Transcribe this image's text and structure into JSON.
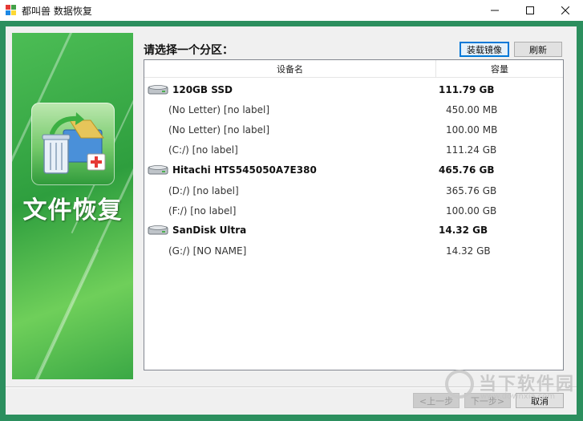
{
  "window": {
    "title": "都叫兽 数据恢复",
    "controls": {
      "minimize": "minimize-icon",
      "maximize": "maximize-icon",
      "close": "close-icon"
    }
  },
  "banner": {
    "icon": "recycle-bin-folder-restore-icon",
    "title": "文件恢复"
  },
  "main": {
    "prompt": "请选择一个分区：",
    "mount_image_label": "装载镜像",
    "refresh_label": "刷新",
    "columns": {
      "device": "设备名",
      "capacity": "容量"
    },
    "rows": [
      {
        "type": "disk",
        "name": "120GB SSD",
        "size": "111.79 GB"
      },
      {
        "type": "partition",
        "name": "(No Letter) [no label]",
        "size": "450.00 MB"
      },
      {
        "type": "partition",
        "name": "(No Letter) [no label]",
        "size": "100.00 MB"
      },
      {
        "type": "partition",
        "name": "(C:/) [no label]",
        "size": "111.24 GB"
      },
      {
        "type": "disk",
        "name": "Hitachi HTS545050A7E380",
        "size": "465.76 GB"
      },
      {
        "type": "partition",
        "name": "(D:/) [no label]",
        "size": "365.76 GB"
      },
      {
        "type": "partition",
        "name": "(F:/) [no label]",
        "size": "100.00 GB"
      },
      {
        "type": "disk",
        "name": "SanDisk Ultra",
        "size": "14.32 GB"
      },
      {
        "type": "partition",
        "name": "(G:/) [NO NAME]",
        "size": "14.32 GB"
      }
    ]
  },
  "footer": {
    "prev_label": "<上一步",
    "next_label": "下一步>",
    "cancel_label": "取消"
  },
  "watermark": {
    "text": "当下软件园",
    "url": "www.downxia.com"
  },
  "colors": {
    "banner_green": "#3aa845",
    "window_frame": "#2c8f5e",
    "focus_blue": "#0078d7"
  }
}
